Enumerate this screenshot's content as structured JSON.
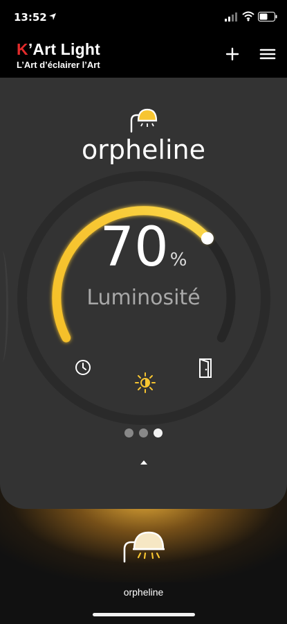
{
  "status_bar": {
    "time": "13:52",
    "icons": [
      "location-arrow-icon",
      "cellular-signal-icon",
      "wifi-icon",
      "battery-icon"
    ]
  },
  "header": {
    "brand_k": "K",
    "brand_rest": "’Art Light",
    "tagline": "L’Art d’éclairer l’Art",
    "add_icon": "plus-icon",
    "menu_icon": "hamburger-menu-icon"
  },
  "control": {
    "light_name": "orpheline",
    "value": "70",
    "unit": "%",
    "label": "Luminosité",
    "brightness_fraction": 0.7,
    "accent_color": "#f7c531",
    "modes": [
      "clock-icon",
      "brightness-sun-icon",
      "door-sensor-icon"
    ],
    "active_mode": "brightness-sun-icon"
  },
  "pager": {
    "count": 3,
    "active_index": 2
  },
  "device_tile": {
    "name": "orpheline",
    "icon": "ceiling-lamp-icon"
  }
}
